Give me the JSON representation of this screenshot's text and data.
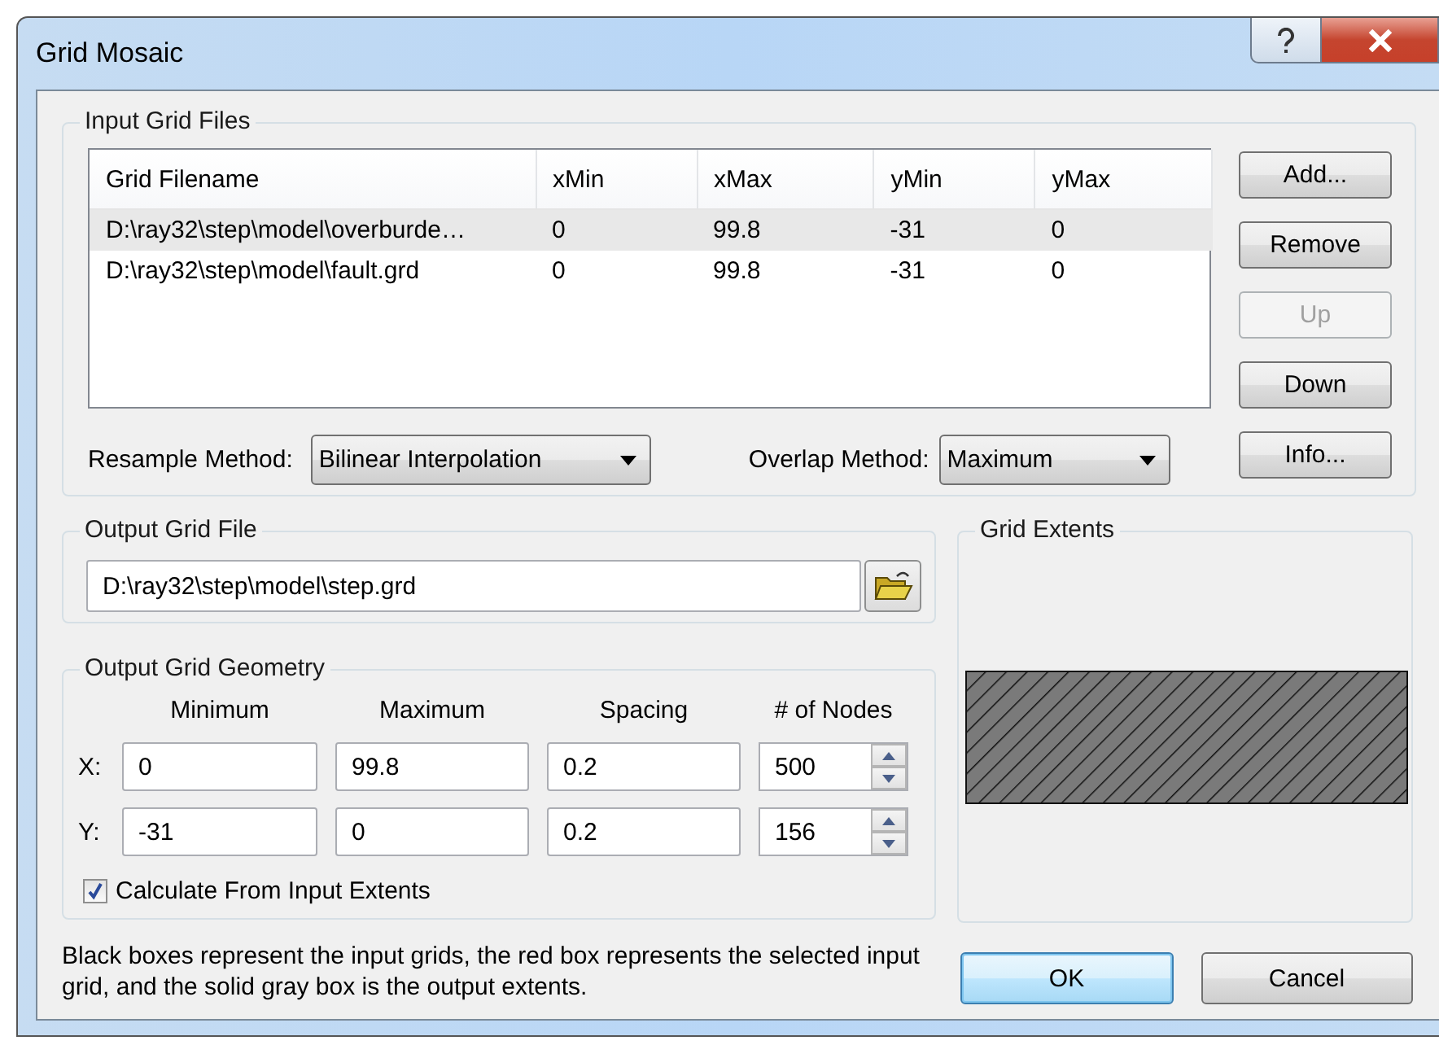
{
  "window": {
    "title": "Grid Mosaic"
  },
  "input_grid_files": {
    "title": "Input Grid Files",
    "table": {
      "columns": [
        "Grid Filename",
        "xMin",
        "xMax",
        "yMin",
        "yMax"
      ],
      "rows": [
        {
          "cells": [
            "D:\\ray32\\step\\model\\overburde…",
            "0",
            "99.8",
            "-31",
            "0"
          ],
          "selected": true
        },
        {
          "cells": [
            "D:\\ray32\\step\\model\\fault.grd",
            "0",
            "99.8",
            "-31",
            "0"
          ],
          "selected": false
        }
      ]
    },
    "buttons": [
      {
        "label": "Add...",
        "disabled": false
      },
      {
        "label": "Remove",
        "disabled": false
      },
      {
        "label": "Up",
        "disabled": true
      },
      {
        "label": "Down",
        "disabled": false
      },
      {
        "label": "Info...",
        "disabled": false
      }
    ],
    "resample_method": {
      "label": "Resample Method:",
      "value": "Bilinear Interpolation"
    },
    "overlap_method": {
      "label": "Overlap Method:",
      "value": "Maximum"
    }
  },
  "output_grid_file": {
    "title": "Output Grid File",
    "value": "D:\\ray32\\step\\model\\step.grd"
  },
  "output_grid_geometry": {
    "title": "Output Grid Geometry",
    "columns": [
      "Minimum",
      "Maximum",
      "Spacing",
      "# of Nodes"
    ],
    "rows": [
      {
        "label": "X:",
        "values": [
          "0",
          "99.8",
          "0.2",
          "500"
        ]
      },
      {
        "label": "Y:",
        "values": [
          "-31",
          "0",
          "0.2",
          "156"
        ]
      }
    ],
    "checkbox": {
      "label": "Calculate From Input Extents",
      "checked": true
    }
  },
  "grid_extents": {
    "title": "Grid Extents"
  },
  "note": "Black boxes represent the input grids, the red box represents the selected input grid, and the solid gray box is the output extents.",
  "buttons": [
    {
      "label": "OK",
      "default": true
    },
    {
      "label": "Cancel",
      "default": false
    }
  ]
}
